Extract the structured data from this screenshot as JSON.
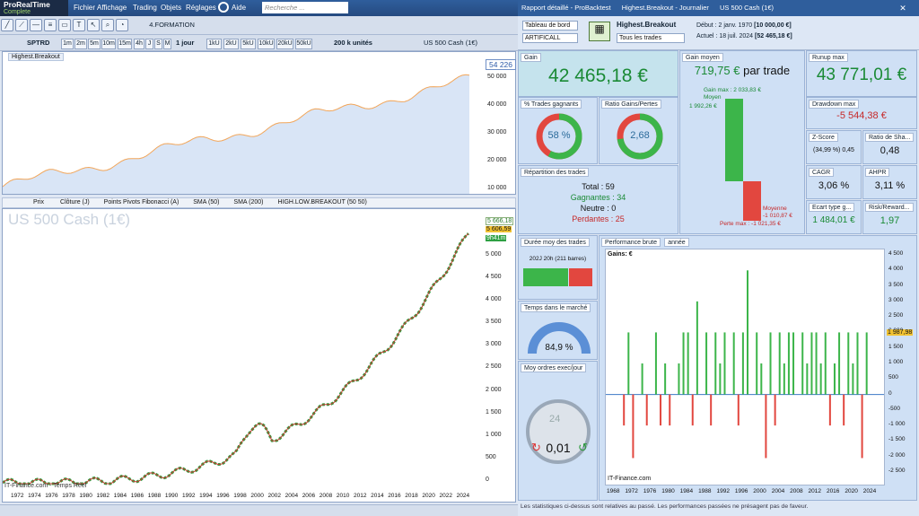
{
  "app": {
    "brand": "ProRealTime",
    "edition": "Complete",
    "menus": [
      "Fichier",
      "Affichage",
      "Trading",
      "Objets",
      "Réglages",
      "Aide"
    ],
    "search_placeholder": "Recherche ...",
    "formation": "4.FORMATION"
  },
  "report": {
    "title": "Rapport détaillé - ProBacktest",
    "strategy_header": "Highest.Breakout - Journalier",
    "instrument": "US 500 Cash (1€)",
    "dashboard_select": "Tableau de bord",
    "account_select": "ARTIFICALL",
    "strategy_name": "Highest.Breakout",
    "trades_select": "Tous les trades",
    "start_label": "Début :",
    "start_value": "2 janv. 1970",
    "start_capital": "[10 000,00 €]",
    "end_label": "Actuel :",
    "end_value": "18 juil. 2024",
    "end_capital": "[52 465,18 €]"
  },
  "toolbar2": {
    "ticker": "SPTRD",
    "timeframes": [
      "1m",
      "2m",
      "5m",
      "10m",
      "15m",
      "4h",
      "J",
      "S",
      "M"
    ],
    "period": "1 jour",
    "units": [
      "1kU",
      "2kU",
      "5kU",
      "10kU",
      "20kU",
      "50kU"
    ],
    "count": "200 k unités",
    "chart_title": "US 500 Cash (1€)"
  },
  "equity": {
    "label": "Highest.Breakout",
    "last": "54 226",
    "yticks": [
      "50 000",
      "40 000",
      "30 000",
      "20 000",
      "10 000"
    ]
  },
  "price": {
    "indicators": [
      "Prix",
      "Clôture (J)",
      "Points Pivots Fibonacci (A)",
      "SMA (50)",
      "SMA (200)",
      "HIGH.LOW.BREAKOUT (50 50)"
    ],
    "watermark": "US 500 Cash (1€)",
    "tag1": "5 666,18",
    "tag2": "5 606,59",
    "tag3": "9h41m",
    "yticks": [
      "5 000",
      "4 500",
      "4 000",
      "3 500",
      "3 000",
      "2 500",
      "2 000",
      "1 500",
      "1 000",
      "500",
      "0"
    ],
    "xticks": [
      "1972",
      "1974",
      "1976",
      "1978",
      "1980",
      "1982",
      "1984",
      "1986",
      "1988",
      "1990",
      "1992",
      "1994",
      "1996",
      "1998",
      "2000",
      "2002",
      "2004",
      "2006",
      "2008",
      "2010",
      "2012",
      "2014",
      "2016",
      "2018",
      "2020",
      "2022",
      "2024"
    ],
    "source": "IT-Finance.com - Temps Réel"
  },
  "stats": {
    "gain_label": "Gain",
    "gain": "42 465,18 €",
    "avg_gain_label": "Gain moyen",
    "avg_gain": "719,75 €",
    "per_trade": "par trade",
    "gain_max": "Gain max : 2 033,83 €",
    "moyen_label": "Moyen",
    "moyen_pos": "1 992,26 €",
    "moyenne_label": "Moyenne",
    "moyenne_neg": "-1 010,87 €",
    "perte_max": "Perte max : -1 021,35 €",
    "runup_label": "Runup max",
    "runup": "43 771,01 €",
    "winrate_label": "% Trades gagnants",
    "winrate": "58 %",
    "ratio_label": "Ratio Gains/Pertes",
    "ratio": "2,68",
    "drawdown_label": "Drawdown max",
    "drawdown": "-5 544,38 €",
    "zscore_label": "Z-Score",
    "zscore": "(34,99 %) 0,45",
    "sharpe_label": "Ratio de Sha...",
    "sharpe": "0,48",
    "cagr_label": "CAGR",
    "cagr": "3,06 %",
    "ahpr_label": "AHPR",
    "ahpr": "3,11 %",
    "stdev_label": "Ecart type g...",
    "stdev": "1 484,01 €",
    "rr_label": "Risk/Reward...",
    "rr": "1,97",
    "rep_label": "Répartition des trades",
    "total": "Total : 59",
    "gagnantes": "Gagnantes : 34",
    "neutre": "Neutre : 0",
    "perdantes": "Perdantes : 25",
    "duration_label": "Durée moy des trades",
    "duration": "202J 20h (211 barres)",
    "market_label": "Temps dans le marché",
    "market": "84,9 %",
    "orders_label": "Moy ordres exec/jour",
    "orders_days": "24",
    "orders": "0,01",
    "perf_label": "Performance brute",
    "perf_period": "année",
    "perf_axis": "Gains: €",
    "perf_last": "1 987,98",
    "perf_source": "IT-Finance.com",
    "footer": "Les statistiques ci-dessus sont relatives au passé. Les performances passées ne présagent pas de faveur."
  },
  "chart_data": {
    "type": "bar",
    "title": "Performance brute",
    "ylabel": "Gains: €",
    "ylim": [
      -2500,
      4500
    ],
    "yticks": [
      "4 500",
      "4 000",
      "3 500",
      "3 000",
      "2 500",
      "2 000",
      "1 500",
      "1 000",
      "500",
      "0",
      "-500",
      "-1 000",
      "-1 500",
      "-2 000",
      "-2 500"
    ],
    "xticks": [
      "1968",
      "1972",
      "1976",
      "1980",
      "1984",
      "1988",
      "1992",
      "1996",
      "2000",
      "2004",
      "2008",
      "2012",
      "2016",
      "2020",
      "2024"
    ],
    "x": [
      1970,
      1971,
      1972,
      1974,
      1975,
      1977,
      1978,
      1979,
      1980,
      1982,
      1983,
      1984,
      1985,
      1986,
      1988,
      1989,
      1990,
      1991,
      1992,
      1994,
      1995,
      1996,
      1997,
      1999,
      2000,
      2001,
      2002,
      2003,
      2004,
      2005,
      2006,
      2007,
      2009,
      2010,
      2011,
      2012,
      2013,
      2014,
      2015,
      2016,
      2017,
      2018,
      2019,
      2020,
      2021,
      2022,
      2023
    ],
    "values": [
      -1000,
      2000,
      -2050,
      1000,
      -1000,
      2000,
      -1000,
      1000,
      -1000,
      1000,
      2000,
      2000,
      -1000,
      3000,
      2000,
      -1000,
      2000,
      1000,
      2000,
      2000,
      -1000,
      2000,
      4000,
      2000,
      1000,
      -2050,
      2000,
      -1000,
      2000,
      1000,
      2000,
      2000,
      2000,
      1000,
      2000,
      2000,
      1000,
      2000,
      -1000,
      1000,
      2000,
      -1000,
      2000,
      1000,
      2000,
      -2050,
      2000
    ],
    "last_label": "1 987,98"
  }
}
